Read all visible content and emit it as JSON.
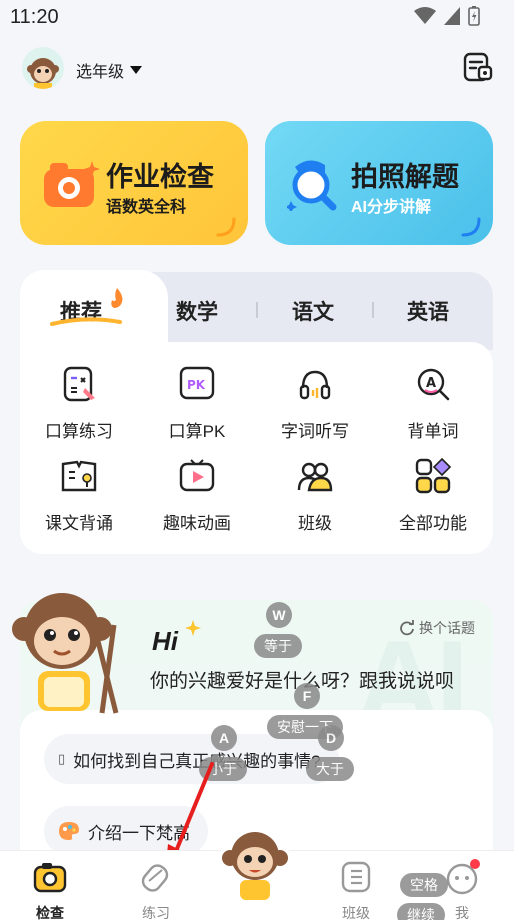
{
  "status": {
    "time": "11:20"
  },
  "header": {
    "grade_label": "选年级"
  },
  "cards": [
    {
      "title": "作业检查",
      "subtitle": "语数英全科"
    },
    {
      "title": "拍照解题",
      "subtitle": "AI分步讲解"
    }
  ],
  "tabs": [
    {
      "label": "推荐",
      "active": true
    },
    {
      "label": "数学"
    },
    {
      "label": "语文"
    },
    {
      "label": "英语"
    }
  ],
  "features": [
    {
      "label": "口算练习",
      "icon": "calc-practice-icon"
    },
    {
      "label": "口算PK",
      "icon": "pk-icon"
    },
    {
      "label": "字词听写",
      "icon": "headphones-icon"
    },
    {
      "label": "背单词",
      "icon": "word-search-icon"
    },
    {
      "label": "课文背诵",
      "icon": "book-recite-icon"
    },
    {
      "label": "趣味动画",
      "icon": "video-play-icon"
    },
    {
      "label": "班级",
      "icon": "class-group-icon"
    },
    {
      "label": "全部功能",
      "icon": "all-apps-icon"
    }
  ],
  "chat": {
    "greeting": "Hi",
    "switch_topic": "换个话题",
    "question": "你的兴趣爱好是什么呀？跟我说说呗",
    "suggestions": [
      "如何找到自己真正感兴趣的事情?",
      "介绍一下梵高"
    ]
  },
  "keyboard_overlay": {
    "w_key": "W",
    "w_label": "等于",
    "f_key": "F",
    "f_label": "安慰一下",
    "a_key": "A",
    "a_label": "小于",
    "d_key": "D",
    "d_label": "大于",
    "space_label": "空格",
    "continue_label": "继续"
  },
  "nav": [
    {
      "label": "检查",
      "active": true
    },
    {
      "label": "练习"
    },
    {
      "label": "班级"
    },
    {
      "label": "我"
    }
  ],
  "colors": {
    "accent_yellow": "#ffd84a",
    "accent_blue": "#4ac0ea",
    "notify_red": "#ff3b4a"
  }
}
